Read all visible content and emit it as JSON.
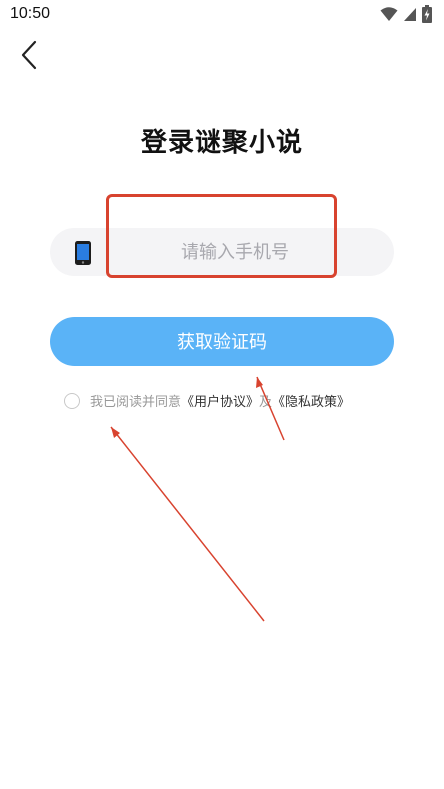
{
  "status_bar": {
    "time": "10:50",
    "icons": [
      "wifi-icon",
      "cellular-signal-icon",
      "battery-charging-icon"
    ]
  },
  "header": {
    "back_icon": "chevron-left-icon"
  },
  "title": "登录谜聚小说",
  "phone_field": {
    "icon": "smartphone-icon",
    "placeholder": "请输入手机号",
    "value": ""
  },
  "code_button": {
    "label": "获取验证码"
  },
  "agreement": {
    "prefix": "我已阅读并同意",
    "user_agreement": "《用户协议》",
    "conjunction": "及",
    "privacy_policy": "《隐私政策》",
    "checked": false
  },
  "annotation": {
    "highlight_color": "#d8432f"
  },
  "colors": {
    "accent": "#5ab3f7",
    "field_background": "#f4f4f6",
    "phone_icon_blue": "#2a7de1"
  }
}
